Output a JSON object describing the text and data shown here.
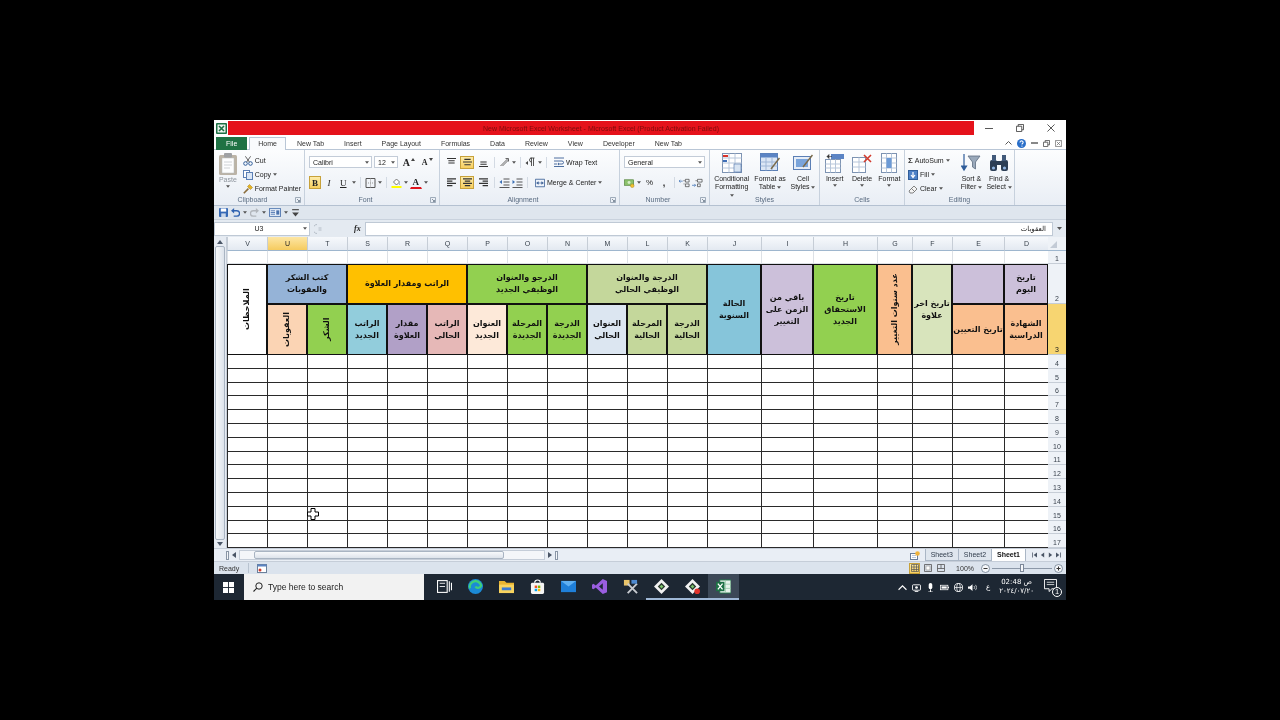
{
  "window": {
    "title": "New Microsoft Excel Worksheet - Microsoft Excel (Product Activation Failed)"
  },
  "ribbon_tabs": [
    {
      "label": "New Tab",
      "kind": "tab",
      "selected": false
    },
    {
      "label": "Developer",
      "kind": "tab",
      "selected": false
    },
    {
      "label": "View",
      "kind": "tab",
      "selected": false
    },
    {
      "label": "Review",
      "kind": "tab",
      "selected": false
    },
    {
      "label": "Data",
      "kind": "tab",
      "selected": false
    },
    {
      "label": "Formulas",
      "kind": "tab",
      "selected": false
    },
    {
      "label": "Page Layout",
      "kind": "tab",
      "selected": false
    },
    {
      "label": "Insert",
      "kind": "tab",
      "selected": false
    },
    {
      "label": "New Tab",
      "kind": "tab",
      "selected": false
    },
    {
      "label": "Home",
      "kind": "tab",
      "selected": true
    },
    {
      "label": "File",
      "kind": "file",
      "selected": false
    }
  ],
  "ribbon": {
    "clipboard": {
      "label": "Clipboard",
      "paste": {
        "label": "Paste",
        "disabled": true
      },
      "cut": "Cut",
      "copy": "Copy",
      "format_painter": "Format Painter"
    },
    "font": {
      "label": "Font",
      "font_name": "Calibri",
      "font_size": "12",
      "grow": "A",
      "shrink": "A",
      "bold": {
        "label": "B",
        "on": true
      },
      "italic": {
        "label": "I",
        "on": false
      },
      "underline": {
        "label": "U",
        "on": false
      },
      "font_color": "A"
    },
    "alignment": {
      "label": "Alignment",
      "vertical": [
        {
          "selected": false
        },
        {
          "selected": true
        },
        {
          "selected": false
        }
      ],
      "horizontal": [
        {
          "selected": false
        },
        {
          "selected": true
        },
        {
          "selected": false
        }
      ],
      "wrap_text": "Wrap Text",
      "merge": "Merge & Center"
    },
    "number": {
      "label": "Number",
      "format": "General",
      "percent": "%",
      "comma": ","
    },
    "styles": {
      "label": "Styles",
      "buttons": [
        "Cell Styles",
        "Format as Table",
        "Conditional Formatting"
      ]
    },
    "cells": {
      "label": "Cells",
      "buttons": [
        "Format",
        "Delete",
        "Insert"
      ]
    },
    "editing": {
      "label": "Editing",
      "autosum_symbol": "Σ",
      "autosum": "AutoSum",
      "fill": "Fill",
      "clear": "Clear",
      "sort": "Sort & Filter",
      "find": "Find & Select"
    }
  },
  "quick_access": [
    {
      "kind": "save",
      "disabled": false
    },
    {
      "kind": "undo",
      "disabled": false
    },
    {
      "kind": "redo",
      "disabled": true
    },
    {
      "kind": "form",
      "disabled": false
    },
    {
      "kind": "customize",
      "disabled": false
    }
  ],
  "formula_bar": {
    "name_box": "U3",
    "function_label": "fx",
    "value": "العقوبات"
  },
  "sheet": {
    "columns": [
      {
        "label": "D",
        "selected": false
      },
      {
        "label": "E",
        "selected": false
      },
      {
        "label": "F",
        "selected": false
      },
      {
        "label": "G",
        "selected": false
      },
      {
        "label": "H",
        "selected": false
      },
      {
        "label": "I",
        "selected": false
      },
      {
        "label": "J",
        "selected": false
      },
      {
        "label": "K",
        "selected": false
      },
      {
        "label": "L",
        "selected": false
      },
      {
        "label": "M",
        "selected": false
      },
      {
        "label": "N",
        "selected": false
      },
      {
        "label": "O",
        "selected": false
      },
      {
        "label": "P",
        "selected": false
      },
      {
        "label": "Q",
        "selected": false
      },
      {
        "label": "R",
        "selected": false
      },
      {
        "label": "S",
        "selected": false
      },
      {
        "label": "T",
        "selected": false
      },
      {
        "label": "U",
        "selected": true
      },
      {
        "label": "V",
        "selected": false
      }
    ],
    "rows": [
      {
        "label": "1",
        "selected": false
      },
      {
        "label": "2",
        "selected": false
      },
      {
        "label": "3",
        "selected": true
      },
      {
        "label": "4",
        "selected": false
      },
      {
        "label": "5",
        "selected": false
      },
      {
        "label": "6",
        "selected": false
      },
      {
        "label": "7",
        "selected": false
      },
      {
        "label": "8",
        "selected": false
      },
      {
        "label": "9",
        "selected": false
      },
      {
        "label": "10",
        "selected": false
      },
      {
        "label": "11",
        "selected": false
      },
      {
        "label": "12",
        "selected": false
      },
      {
        "label": "13",
        "selected": false
      },
      {
        "label": "14",
        "selected": false
      },
      {
        "label": "15",
        "selected": false
      },
      {
        "label": "16",
        "selected": false
      },
      {
        "label": "17",
        "selected": false
      }
    ],
    "header": [
      {
        "label": "تاريخ اليوم",
        "color": "#ccc0da",
        "rotated": false,
        "children": [
          {
            "label": "الشهادة الدراسية",
            "color": "#fabf8f",
            "rotated": false
          }
        ]
      },
      {
        "color": "#ccc0da",
        "children": [
          {
            "label": "تاريخ التعيين",
            "color": "#fabf8f",
            "rotated": false
          }
        ]
      },
      {
        "label": "تاريخ اخر علاوة",
        "color": "#d8e4bc",
        "rotated": false
      },
      {
        "label": "عدد سنوات التغيير",
        "color": "#fabf8f",
        "rotated": true
      },
      {
        "label": "تاريخ الاستحقاق الجديد",
        "color": "#92d050",
        "rotated": false
      },
      {
        "label": "باقي من الزمن على التغيير",
        "color": "#ccc0da",
        "rotated": false
      },
      {
        "label": "الحالة السنوية",
        "color": "#86c5da",
        "rotated": false
      },
      {
        "label": "الدرجة والعنوان الوظيفي الحالي",
        "color": "#c4d79b",
        "rotated": false,
        "children": [
          {
            "label": "الدرجة الحالية",
            "color": "#c4d79b",
            "rotated": false
          },
          {
            "label": "المرحلة الحالية",
            "color": "#c4d79b",
            "rotated": false
          },
          {
            "label": "العنوان الحالي",
            "color": "#dce6f1",
            "rotated": false
          }
        ]
      },
      {
        "label": "الدرجو والعنوان الوظيفي الجديد",
        "color": "#92d050",
        "rotated": false,
        "children": [
          {
            "label": "الدرجة الجديدة",
            "color": "#92d050",
            "rotated": false
          },
          {
            "label": "المرحلة الجديدة",
            "color": "#92d050",
            "rotated": false
          },
          {
            "label": "العنوان الجديد",
            "color": "#fde9d9",
            "rotated": false
          }
        ]
      },
      {
        "label": "الراتب ومقدار العلاوة",
        "color": "#ffc000",
        "rotated": false,
        "children": [
          {
            "label": "الراتب الحالي",
            "color": "#e6b8b7",
            "rotated": false
          },
          {
            "label": "مقدار العلاوة",
            "color": "#b1a0c7",
            "rotated": false
          },
          {
            "label": "الراتب الجديد",
            "color": "#92cddc",
            "rotated": false
          }
        ]
      },
      {
        "label": "كتب الشكر والعقوبات",
        "color": "#95b3d7",
        "rotated": false,
        "children": [
          {
            "label": "الشكر",
            "color": "#92d050",
            "rotated": true
          },
          {
            "label": "العقوبات",
            "color": "#fbd4b4",
            "rotated": true
          }
        ]
      },
      {
        "label": "الملاحظات",
        "color": "#ffffff",
        "rotated": true
      }
    ]
  },
  "sheet_tabs": [
    {
      "label": "Sheet1",
      "selected": true
    },
    {
      "label": "Sheet2",
      "selected": false
    },
    {
      "label": "Sheet3",
      "selected": false
    }
  ],
  "status_bar": {
    "mode": "Ready",
    "views": [
      {
        "selected": true
      },
      {
        "selected": false
      },
      {
        "selected": false
      }
    ],
    "zoom": {
      "label": "100%",
      "level": 0.5
    }
  },
  "taskbar": {
    "search": {
      "placeholder": "Type here to search"
    },
    "apps": [
      {
        "kind": "task-view",
        "running": false,
        "selected": false
      },
      {
        "kind": "browser",
        "running": false,
        "selected": false
      },
      {
        "kind": "folder",
        "running": false,
        "selected": false
      },
      {
        "kind": "store",
        "running": false,
        "selected": false
      },
      {
        "kind": "mail",
        "running": false,
        "selected": false
      },
      {
        "kind": "code",
        "running": false,
        "selected": false
      },
      {
        "kind": "tools",
        "running": false,
        "selected": false
      },
      {
        "kind": "diamond",
        "running": true,
        "selected": false
      },
      {
        "kind": "diamond-badge",
        "running": true,
        "selected": false
      },
      {
        "kind": "spreadsheet",
        "running": true,
        "selected": true
      }
    ],
    "language": "ع",
    "time": "02:48 ص",
    "date": "٢٠٢٤/٠٧/٢٠",
    "notifications": "1"
  }
}
